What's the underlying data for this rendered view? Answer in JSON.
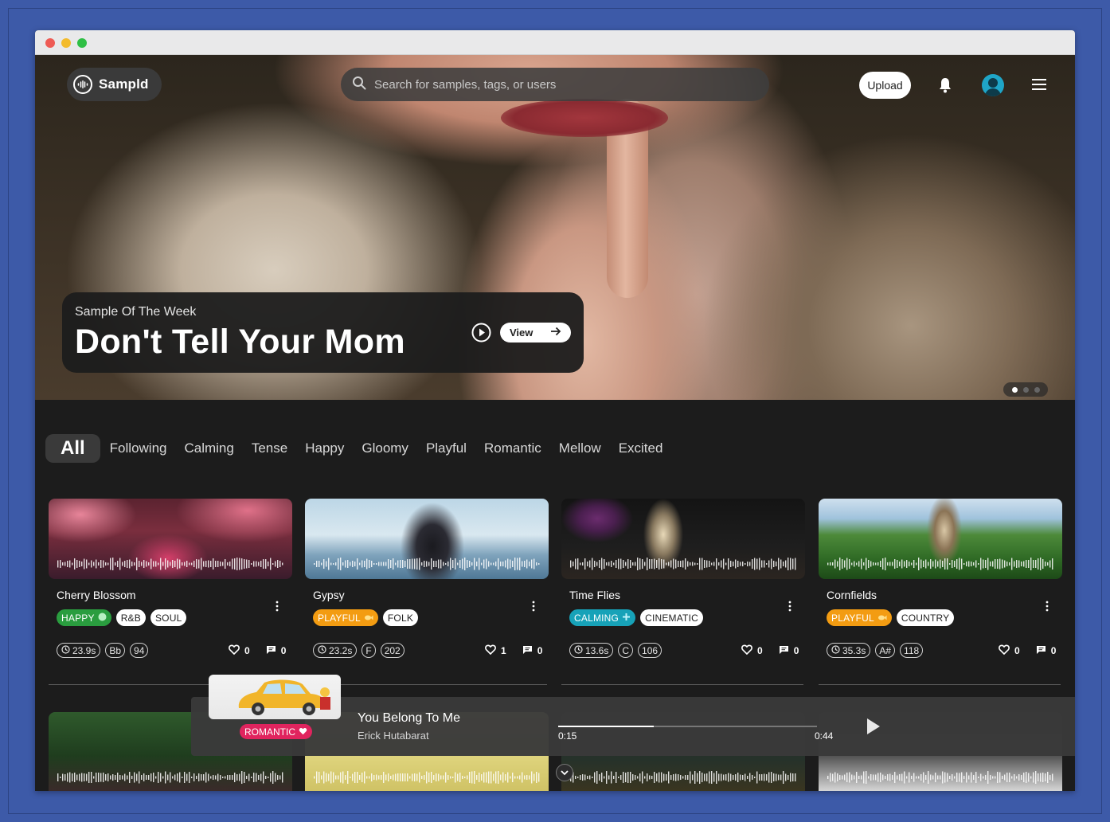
{
  "colors": {
    "accent_green": "#2a9d3f",
    "accent_orange": "#f39c12",
    "accent_teal": "#17a2b8",
    "accent_pink": "#e0245e"
  },
  "header": {
    "logo_text": "Sampld",
    "search_placeholder": "Search for samples, tags, or users",
    "upload_label": "Upload",
    "icons": [
      "search-icon",
      "bell-icon",
      "avatar",
      "hamburger-menu-icon"
    ]
  },
  "hero": {
    "label": "Sample Of The Week",
    "title": "Don't Tell Your Mom",
    "view_label": "View",
    "carousel": {
      "count": 3,
      "active": 1
    }
  },
  "filters": {
    "items": [
      "All",
      "Following",
      "Calming",
      "Tense",
      "Happy",
      "Gloomy",
      "Playful",
      "Romantic",
      "Mellow",
      "Excited"
    ],
    "active": "All"
  },
  "cards": [
    {
      "title": "Cherry Blossom",
      "mood": "HAPPY",
      "mood_color": "#2a9d3f",
      "mood_icon": "smile-icon",
      "genre": "R&B",
      "genre2": "SOUL",
      "duration": "23.9s",
      "key": "Bb",
      "bpm": "94",
      "likes": "0",
      "comments": "0"
    },
    {
      "title": "Gypsy",
      "mood": "PLAYFUL",
      "mood_color": "#f39c12",
      "mood_icon": "fish-icon",
      "genre": "FOLK",
      "duration": "23.2s",
      "key": "F",
      "bpm": "202",
      "likes": "1",
      "comments": "0"
    },
    {
      "title": "Time Flies",
      "mood": "CALMING",
      "mood_color": "#17a2b8",
      "mood_icon": "calm-icon",
      "genre": "CINEMATIC",
      "duration": "13.6s",
      "key": "C",
      "bpm": "106",
      "likes": "0",
      "comments": "0"
    },
    {
      "title": "Cornfields",
      "mood": "PLAYFUL",
      "mood_color": "#f39c12",
      "mood_icon": "fish-icon",
      "genre": "COUNTRY",
      "duration": "35.3s",
      "key": "A#",
      "bpm": "118",
      "likes": "0",
      "comments": "0"
    }
  ],
  "player": {
    "title": "You Belong To Me",
    "artist": "Erick Hutabarat",
    "mood": "ROMANTIC",
    "mood_icon": "heart-icon",
    "current_time": "0:15",
    "total_time": "0:44",
    "progress": 0.37
  }
}
